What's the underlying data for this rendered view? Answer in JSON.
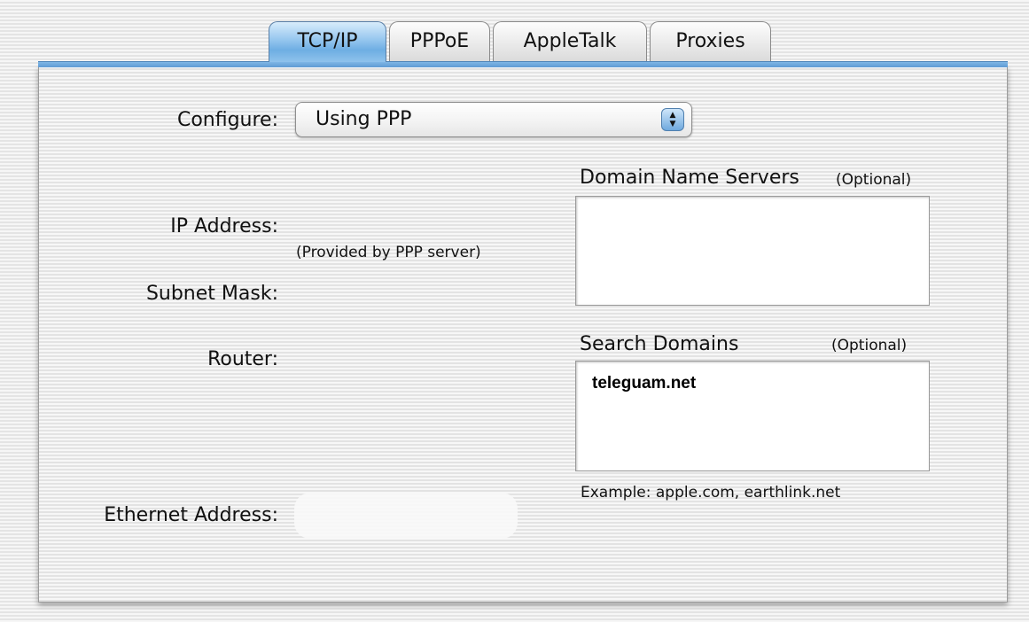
{
  "tabs": [
    {
      "label": "TCP/IP",
      "active": true
    },
    {
      "label": "PPPoE",
      "active": false
    },
    {
      "label": "AppleTalk",
      "active": false
    },
    {
      "label": "Proxies",
      "active": false
    }
  ],
  "configure": {
    "label": "Configure:",
    "value": "Using PPP"
  },
  "fields": {
    "ip_address_label": "IP Address:",
    "provided_note": "(Provided by PPP server)",
    "subnet_mask_label": "Subnet Mask:",
    "router_label": "Router:",
    "ethernet_address_label": "Ethernet Address:"
  },
  "dns": {
    "label": "Domain Name Servers",
    "optional": "(Optional)",
    "value": ""
  },
  "search_domains": {
    "label": "Search Domains",
    "optional": "(Optional)",
    "entries": [
      "teleguam.net"
    ],
    "example": "Example: apple.com, earthlink.net"
  },
  "colors": {
    "accent_blue": "#6eaee3"
  }
}
